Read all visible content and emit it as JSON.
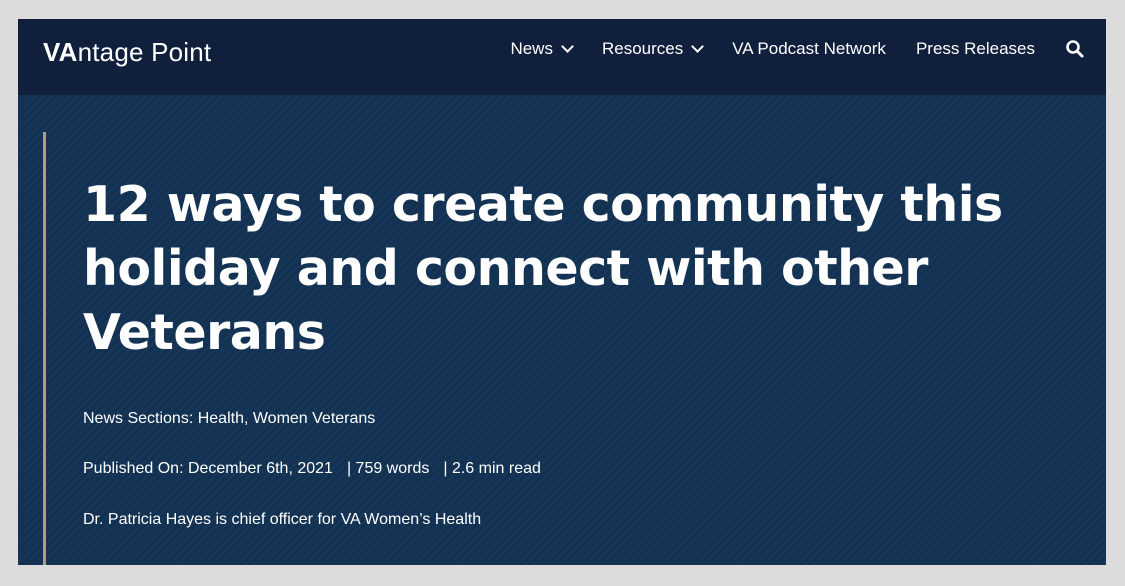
{
  "brand": {
    "bold": "VA",
    "rest": "ntage Point"
  },
  "nav": {
    "items": [
      {
        "label": "News",
        "has_dropdown": true
      },
      {
        "label": "Resources",
        "has_dropdown": true
      },
      {
        "label": "VA Podcast Network",
        "has_dropdown": false
      },
      {
        "label": "Press Releases",
        "has_dropdown": false
      }
    ],
    "search_icon": "search-icon"
  },
  "article": {
    "title": "12 ways to create community this holiday and connect with other Veterans",
    "sections": "News Sections: Health, Women Veterans",
    "published": "Published On: December 6th, 2021",
    "word_count": "| 759 words",
    "read_time": "| 2.6 min read",
    "byline": "Dr. Patricia Hayes is chief officer for VA Women’s Health"
  },
  "colors": {
    "navbar_bg": "#0f1f3c",
    "hero_bg": "#133253",
    "accent_bar": "#b89a6e",
    "page_bg": "#dcdcdc"
  }
}
